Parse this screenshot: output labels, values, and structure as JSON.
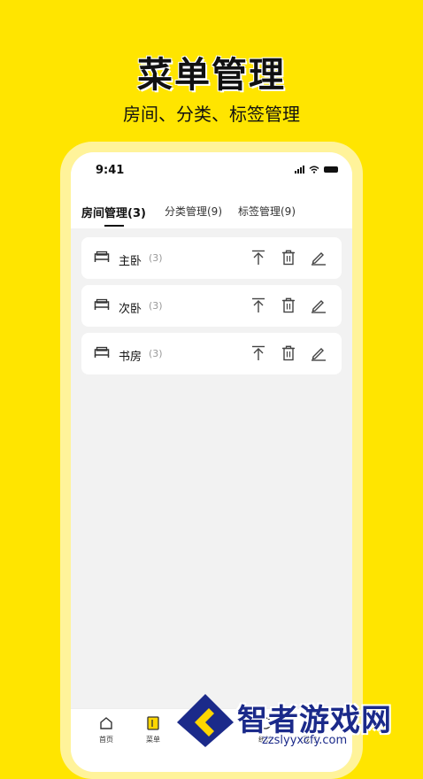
{
  "promo": {
    "title": "菜单管理",
    "subtitle": "房间、分类、标签管理"
  },
  "status_bar": {
    "time": "9:41"
  },
  "tabs": [
    {
      "label": "房间管理(3)",
      "active": true
    },
    {
      "label": "分类管理(9)",
      "active": false
    },
    {
      "label": "标签管理(9)",
      "active": false
    }
  ],
  "rooms": [
    {
      "name": "主卧",
      "count": "(3)",
      "icon": "bed-icon"
    },
    {
      "name": "次卧",
      "count": "(3)",
      "icon": "bed-icon"
    },
    {
      "name": "书房",
      "count": "(3)",
      "icon": "bed-icon"
    }
  ],
  "bottom_nav": [
    {
      "label": "首页",
      "icon": "home-icon"
    },
    {
      "label": "菜单",
      "icon": "menu-book-icon"
    },
    {
      "label": "统计",
      "icon": "stats-icon"
    },
    {
      "label": "我的",
      "icon": "profile-icon"
    }
  ],
  "watermark": {
    "name": "智者游戏网",
    "url": "zzslyyxcfy.com"
  },
  "colors": {
    "background": "#FFE500",
    "accent": "#FFD600",
    "watermark": "#1b2a8a"
  }
}
